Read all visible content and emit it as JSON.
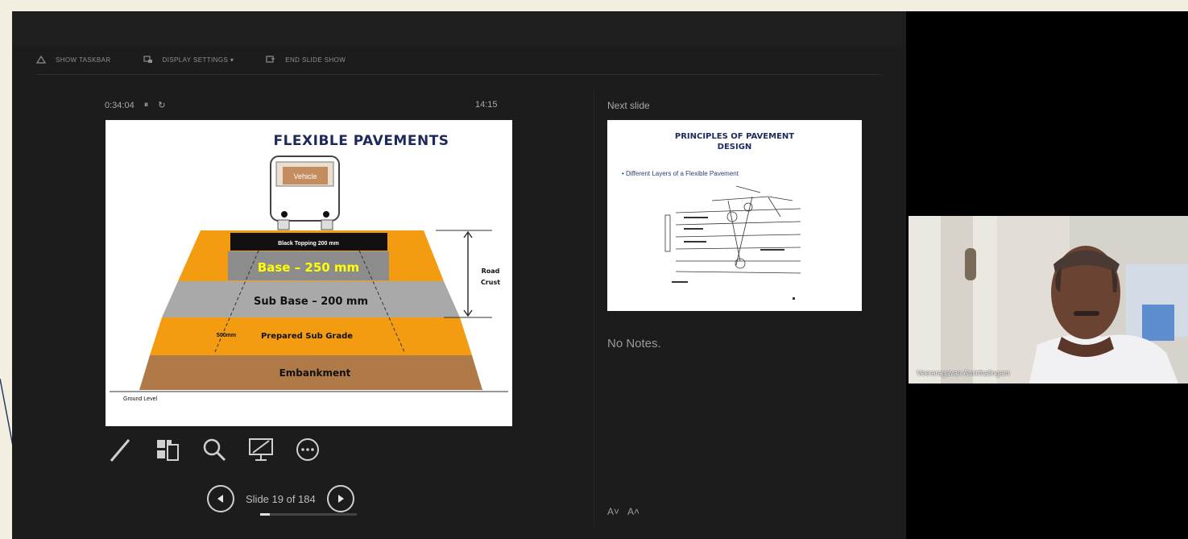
{
  "toolbar": {
    "show_taskbar": "SHOW TASKBAR",
    "display_settings": "DISPLAY SETTINGS ▾",
    "end_slide_show": "END SLIDE SHOW"
  },
  "window_controls": [
    "–",
    "▫",
    "×"
  ],
  "presenter": {
    "elapsed_time": "0:34:04",
    "clock": "14:15",
    "slide_counter": "Slide 19 of 184",
    "progress_fraction": 0.1
  },
  "current_slide": {
    "title": "FLEXIBLE PAVEMENTS",
    "vehicle_label": "Vehicle",
    "layers": {
      "wearing": "Black Topping 200 mm",
      "base": "Base – 250 mm",
      "sub_base": "Sub Base – 200 mm",
      "subgrade": "Prepared Sub Grade",
      "subgrade_note": "500mm",
      "embankment": "Embankment"
    },
    "road_crust_label": [
      "Road",
      "Crust"
    ],
    "ground_label": "Ground Level"
  },
  "next_slide": {
    "heading": "Next slide",
    "title_line1": "PRINCIPLES OF PAVEMENT",
    "title_line2": "DESIGN",
    "bullet": "• Different Layers of a Flexible Pavement"
  },
  "notes": {
    "text": "No Notes."
  },
  "video": {
    "participant_name": "Veeraragavan Amirthalingam"
  },
  "colors": {
    "orange": "#f39c12",
    "gray_layer": "#a6a6a6",
    "brown": "#8b5a2b",
    "slide_title": "#1d2a5a",
    "base_text": "#ffff00"
  }
}
